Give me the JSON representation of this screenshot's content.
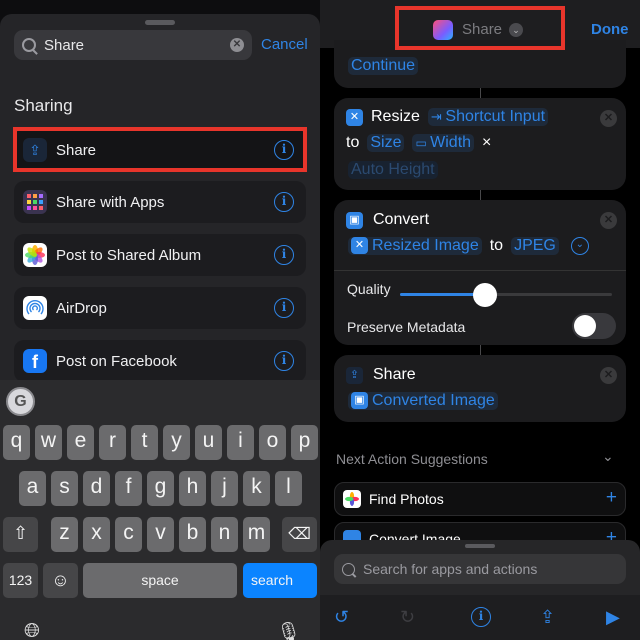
{
  "left_panel": {
    "search": {
      "value": "Share",
      "cancel_label": "Cancel"
    },
    "section_title": "Sharing",
    "results": [
      {
        "label": "Share",
        "icon": "share-icon",
        "highlighted": true
      },
      {
        "label": "Share with Apps",
        "icon": "app-grid-icon"
      },
      {
        "label": "Post to Shared Album",
        "icon": "photos-icon"
      },
      {
        "label": "AirDrop",
        "icon": "airdrop-icon"
      },
      {
        "label": "Post on Facebook",
        "icon": "facebook-icon"
      }
    ],
    "info_glyph": "i",
    "keyboard": {
      "row1": [
        "q",
        "w",
        "e",
        "r",
        "t",
        "y",
        "u",
        "i",
        "o",
        "p"
      ],
      "row2": [
        "a",
        "s",
        "d",
        "f",
        "g",
        "h",
        "j",
        "k",
        "l"
      ],
      "row3": [
        "z",
        "x",
        "c",
        "v",
        "b",
        "n",
        "m"
      ],
      "numbers_label": "123",
      "space_label": "space",
      "search_label": "search",
      "grammarly_glyph": "G"
    }
  },
  "right_panel": {
    "nav": {
      "title": "Share",
      "done_label": "Done"
    },
    "continue_label": "Continue",
    "resize_action": {
      "title": "Resize",
      "input": "Shortcut Input",
      "to": "to",
      "size": "Size",
      "width": "Width",
      "times": "×",
      "height_placeholder": "Auto Height"
    },
    "convert_action": {
      "title": "Convert",
      "input": "Resized Image",
      "to": "to",
      "format": "JPEG",
      "quality_label": "Quality",
      "quality_value": 0.4,
      "preserve_metadata_label": "Preserve Metadata",
      "preserve_metadata": false
    },
    "share_action": {
      "title": "Share",
      "input": "Converted Image"
    },
    "suggestions": {
      "header": "Next Action Suggestions",
      "items": [
        {
          "label": "Find Photos"
        },
        {
          "label": "Convert Image"
        }
      ]
    },
    "bottom_search": {
      "placeholder": "Search for apps and actions"
    }
  },
  "colors": {
    "accent": "#2f84e5",
    "highlight": "#e8352b",
    "keyboard_search": "#0b84ff"
  }
}
